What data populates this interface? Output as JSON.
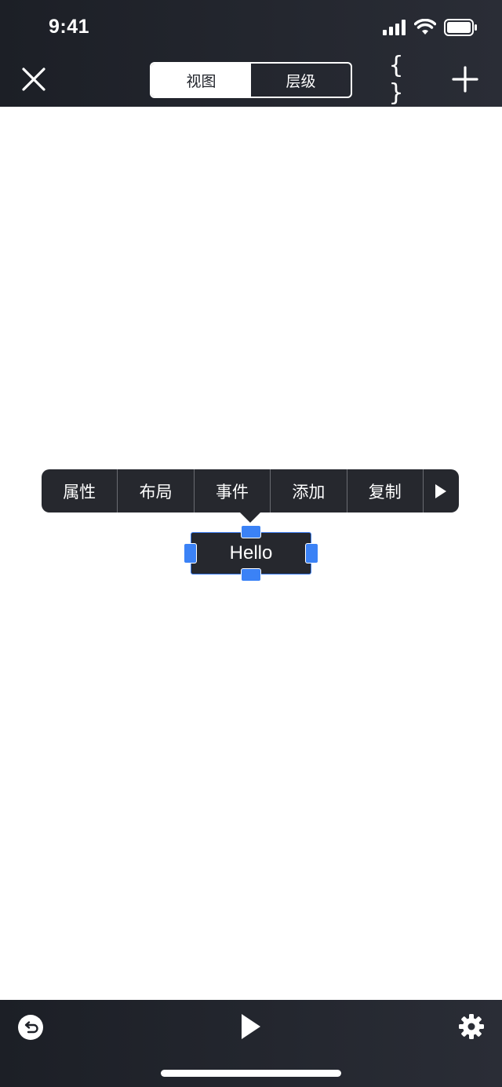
{
  "status": {
    "time": "9:41"
  },
  "header": {
    "tabs": [
      {
        "label": "视图",
        "active": true
      },
      {
        "label": "层级",
        "active": false
      }
    ],
    "close_icon": "close-icon",
    "braces_icon": "code-braces-icon",
    "braces_label": "{ }",
    "add_icon": "plus-icon"
  },
  "context_menu": {
    "items": [
      {
        "label": "属性"
      },
      {
        "label": "布局"
      },
      {
        "label": "事件"
      },
      {
        "label": "添加"
      },
      {
        "label": "复制"
      }
    ],
    "more_icon": "play-triangle-icon"
  },
  "canvas": {
    "selected_element_text": "Hello",
    "selection_color": "#3b82f6"
  },
  "footer": {
    "undo_icon": "undo-icon",
    "play_icon": "play-icon",
    "settings_icon": "gear-icon"
  },
  "colors": {
    "bar_background": "#1c1f26",
    "menu_background": "#26282e",
    "accent": "#3b82f6"
  }
}
